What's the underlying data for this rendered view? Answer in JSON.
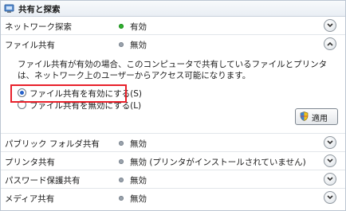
{
  "header": {
    "title": "共有と探索",
    "icon": "sharing-icon"
  },
  "network_discovery": {
    "label": "ネットワーク探索",
    "status": "有効"
  },
  "file_sharing": {
    "label": "ファイル共有",
    "status": "無効",
    "description": "ファイル共有が有効の場合、このコンピュータで共有しているファイルとプリンタは、ネットワーク上のユーザーからアクセス可能になります。",
    "option_enable": "ファイル共有を有効にする(S)",
    "option_disable": "ファイル共有を無効にする(L)",
    "selected": "enable",
    "apply_label": "適用"
  },
  "public_folder": {
    "label": "パブリック フォルダ共有",
    "status": "無効"
  },
  "printer_sharing": {
    "label": "プリンタ共有",
    "status": "無効 (プリンタがインストールされていません)"
  },
  "password_protected": {
    "label": "パスワード保護共有",
    "status": "無効"
  },
  "media_sharing": {
    "label": "メディア共有",
    "status": "無効"
  },
  "colors": {
    "enabled": "#2db22d",
    "disabled": "#9aa3ad",
    "highlight": "#e8202a"
  }
}
